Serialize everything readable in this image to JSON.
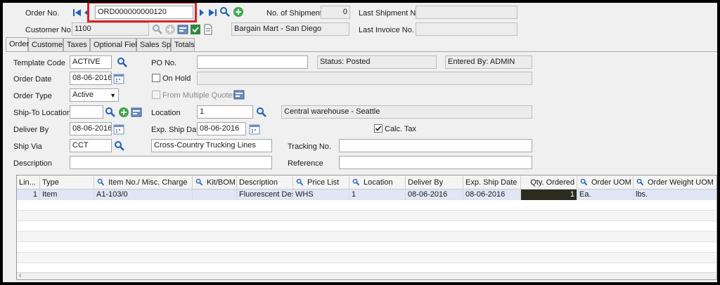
{
  "header": {
    "order_no_label": "Order No.",
    "order_no_value": "ORD000000000120",
    "customer_no_label": "Customer No.",
    "customer_no_value": "1100",
    "customer_name": "Bargain Mart - San Diego",
    "shipments_label": "No. of Shipments",
    "shipments_value": "0",
    "last_shipment_label": "Last Shipment No.",
    "last_shipment_value": "",
    "last_invoice_label": "Last Invoice No.",
    "last_invoice_value": ""
  },
  "tabs": [
    {
      "label": "Order"
    },
    {
      "label": "Customer"
    },
    {
      "label": "Taxes"
    },
    {
      "label": "Optional Fields"
    },
    {
      "label": "Sales Split"
    },
    {
      "label": "Totals"
    }
  ],
  "form": {
    "template_code_label": "Template Code",
    "template_code_value": "ACTIVE",
    "po_no_label": "PO No.",
    "po_no_value": "",
    "status_text": "Status: Posted",
    "entered_by_text": "Entered By: ADMIN",
    "order_date_label": "Order Date",
    "order_date_value": "08-06-2016",
    "on_hold_label": "On Hold",
    "on_hold_text": "",
    "order_type_label": "Order Type",
    "order_type_value": "Active",
    "from_quotes_label": "From Multiple Quotes",
    "ship_to_label": "Ship-To Location",
    "ship_to_value": "",
    "location_label": "Location",
    "location_value": "1",
    "location_name": "Central warehouse - Seattle",
    "deliver_by_label": "Deliver By",
    "deliver_by_value": "08-06-2016",
    "exp_ship_label": "Exp. Ship Date",
    "exp_ship_value": "08-06-2016",
    "calc_tax_label": "Calc. Tax",
    "ship_via_label": "Ship Via",
    "ship_via_value": "CCT",
    "ship_via_name": "Cross-Country Trucking Lines",
    "tracking_label": "Tracking No.",
    "tracking_value": "",
    "description_label": "Description",
    "description_value": "",
    "reference_label": "Reference",
    "reference_value": ""
  },
  "grid": {
    "columns": [
      {
        "label": "Lin..."
      },
      {
        "label": "Type"
      },
      {
        "label": "Item No./ Misc. Charge"
      },
      {
        "label": "Kit/BOM"
      },
      {
        "label": "Description"
      },
      {
        "label": "Price List"
      },
      {
        "label": "Location"
      },
      {
        "label": "Deliver By"
      },
      {
        "label": "Exp. Ship Date"
      },
      {
        "label": "Qty. Ordered"
      },
      {
        "label": "Order UOM"
      },
      {
        "label": "Order Weight UOM"
      }
    ],
    "rows": [
      {
        "line": "1",
        "type": "Item",
        "item": "A1-103/0",
        "kit": "",
        "description": "Fluorescent Des...",
        "price_list": "WHS",
        "location": "1",
        "deliver_by": "08-06-2016",
        "exp_ship": "08-06-2016",
        "qty": "1",
        "uom": "Ea.",
        "weight_uom": "lbs."
      }
    ]
  },
  "colors": {
    "highlight": "#d9232a",
    "accent_blue": "#1f5fbf",
    "add_green": "#3aa84a"
  }
}
